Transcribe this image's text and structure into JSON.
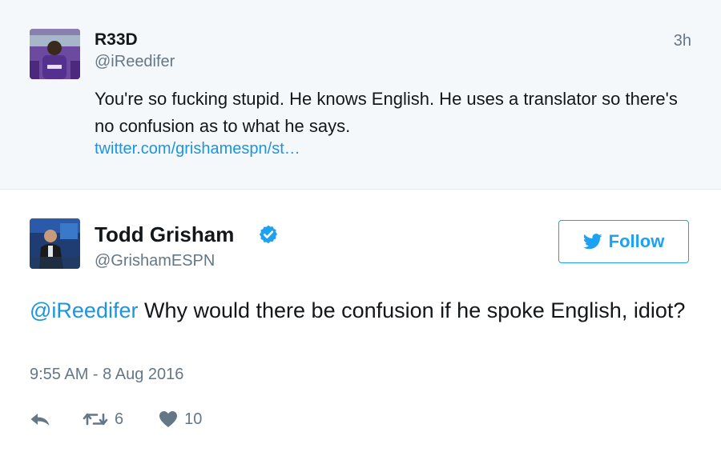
{
  "reply_tweet": {
    "user_name": "R33D",
    "handle": "@iReedifer",
    "time": "3h",
    "text": "You're so fucking stupid. He knows English. He uses a translator so there's no confusion as to what he says.",
    "link": "twitter.com/grishamespn/st…"
  },
  "main_tweet": {
    "user_name": "Todd Grisham",
    "handle": "@GrishamESPN",
    "follow_label": "Follow",
    "mention": "@iReedifer",
    "text": " Why would there be confusion if he spoke English, idiot?",
    "timestamp": "9:55 AM - 8 Aug 2016",
    "retweet_count": "6",
    "like_count": "10"
  },
  "colors": {
    "accent": "#1da1f2",
    "link": "#1b95e0",
    "muted": "#657786",
    "icon": "#aab8c2",
    "reply_bg": "#f5f8fa"
  },
  "icons": {
    "verified": "verified-badge-icon",
    "follow": "twitter-bird-icon",
    "reply": "reply-arrow-icon",
    "retweet": "retweet-icon",
    "like": "heart-icon"
  }
}
